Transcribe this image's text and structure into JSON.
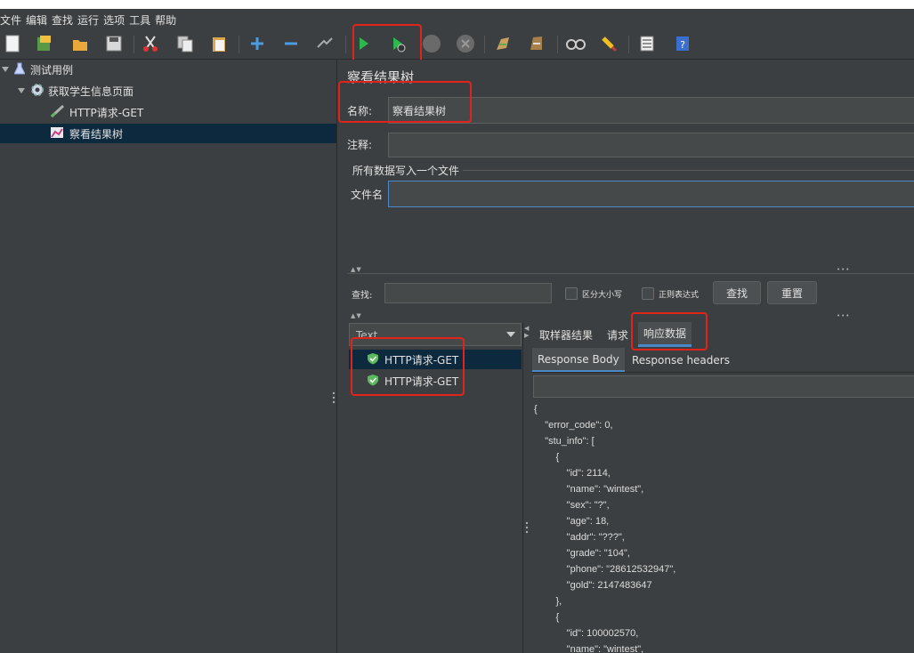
{
  "menu": [
    "文件",
    "编辑",
    "查找",
    "运行",
    "选项",
    "工具",
    "帮助"
  ],
  "toolbar_icons": [
    "new-icon",
    "templates-icon",
    "open-icon",
    "save-icon",
    "cut-icon",
    "copy-icon",
    "paste-icon",
    "expand-icon",
    "collapse-icon",
    "toggle-icon",
    "start-icon",
    "start-no-pauses-icon",
    "stop-icon",
    "shutdown-icon",
    "clear-icon",
    "clear-all-icon",
    "search-icon",
    "reset-search-icon",
    "function-helper-icon",
    "help-icon"
  ],
  "tree": {
    "items": [
      {
        "label": "测试用例",
        "icon": "flask-icon"
      },
      {
        "label": "获取学生信息页面",
        "icon": "gear-icon"
      },
      {
        "label": "HTTP请求-GET",
        "icon": "sampler-icon"
      },
      {
        "label": "察看结果树",
        "icon": "listener-icon"
      }
    ]
  },
  "panel": {
    "title": "察看结果树",
    "name_label": "名称:",
    "name_value": "察看结果树",
    "comment_label": "注释:",
    "comment_value": "",
    "file_group_label": "所有数据写入一个文件",
    "filename_label": "文件名",
    "filename_value": "",
    "search_label": "查找:",
    "search_value": "",
    "case_sensitive_label": "区分大小写",
    "regex_label": "正则表达式",
    "find_button": "查找",
    "reset_button": "重置"
  },
  "results": {
    "renderer": "Text",
    "items": [
      "HTTP请求-GET",
      "HTTP请求-GET"
    ],
    "tabs": [
      "取样器结果",
      "请求",
      "响应数据"
    ],
    "active_tab": "响应数据",
    "subtabs": [
      "Response Body",
      "Response headers"
    ],
    "response_search": "",
    "json_lines": [
      "{",
      "    \"error_code\": 0,",
      "    \"stu_info\": [",
      "        {",
      "            \"id\": 2114,",
      "            \"name\": \"wintest\",",
      "            \"sex\": \"?\",",
      "            \"age\": 18,",
      "            \"addr\": \"???\",",
      "            \"grade\": \"104\",",
      "            \"phone\": \"28612532947\",",
      "            \"gold\": 2147483647",
      "        },",
      "        {",
      "            \"id\": 100002570,",
      "            \"name\": \"wintest\","
    ]
  },
  "colors": {
    "background": "#3c3f41",
    "selected": "#0d293e",
    "annotation_red": "#e0241c",
    "success_green": "#5cb85c",
    "tab_underline": "#4a88c7"
  }
}
